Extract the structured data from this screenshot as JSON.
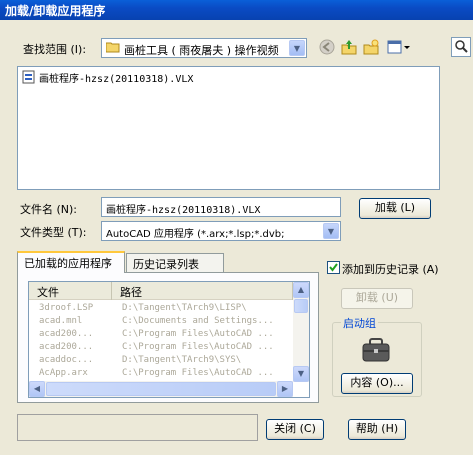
{
  "window": {
    "title": "加载/卸载应用程序"
  },
  "lookin": {
    "label": "查找范围 (I):",
    "value": "画桩工具 ( 雨夜屠夫 ) 操作视频"
  },
  "toolbar": {
    "back_icon": "back-arrow-icon",
    "up_icon": "up-folder-icon",
    "newfolder_icon": "new-folder-icon",
    "views_icon": "views-menu-icon",
    "top_right_icon": "magnifier-icon"
  },
  "files": [
    {
      "name": "画桩程序-hzsz(20110318).VLX",
      "icon": "vlx-file-icon"
    }
  ],
  "filename": {
    "label": "文件名 (N):",
    "value": "画桩程序-hzsz(20110318).VLX"
  },
  "filetype": {
    "label": "文件类型 (T):",
    "value": "AutoCAD 应用程序 (*.arx;*.lsp;*.dvb;"
  },
  "buttons": {
    "load": "加载 (L)",
    "unload": "卸载 (U)",
    "contents": "内容 (O)...",
    "close": "关闭 (C)",
    "help": "帮助 (H)"
  },
  "history_checkbox": {
    "label": "添加到历史记录 (A)",
    "checked": true
  },
  "tabs": [
    {
      "label": "已加载的应用程序",
      "active": true
    },
    {
      "label": "历史记录列表",
      "active": false
    }
  ],
  "loaded_apps": {
    "columns": [
      "文件",
      "路径"
    ],
    "rows": [
      {
        "file": "3droof.LSP",
        "path": "D:\\Tangent\\TArch9\\LISP\\"
      },
      {
        "file": "acad.mnl",
        "path": "C:\\Documents and Settings..."
      },
      {
        "file": "acad200...",
        "path": "C:\\Program Files\\AutoCAD ..."
      },
      {
        "file": "acad200...",
        "path": "C:\\Program Files\\AutoCAD ..."
      },
      {
        "file": "acaddoc...",
        "path": "D:\\Tangent\\TArch9\\SYS\\"
      },
      {
        "file": "AcApp.arx",
        "path": "C:\\Program Files\\AutoCAD ..."
      }
    ]
  },
  "startup_group": {
    "label": "启动组",
    "icon": "briefcase-icon"
  },
  "status": {
    "text": ""
  }
}
